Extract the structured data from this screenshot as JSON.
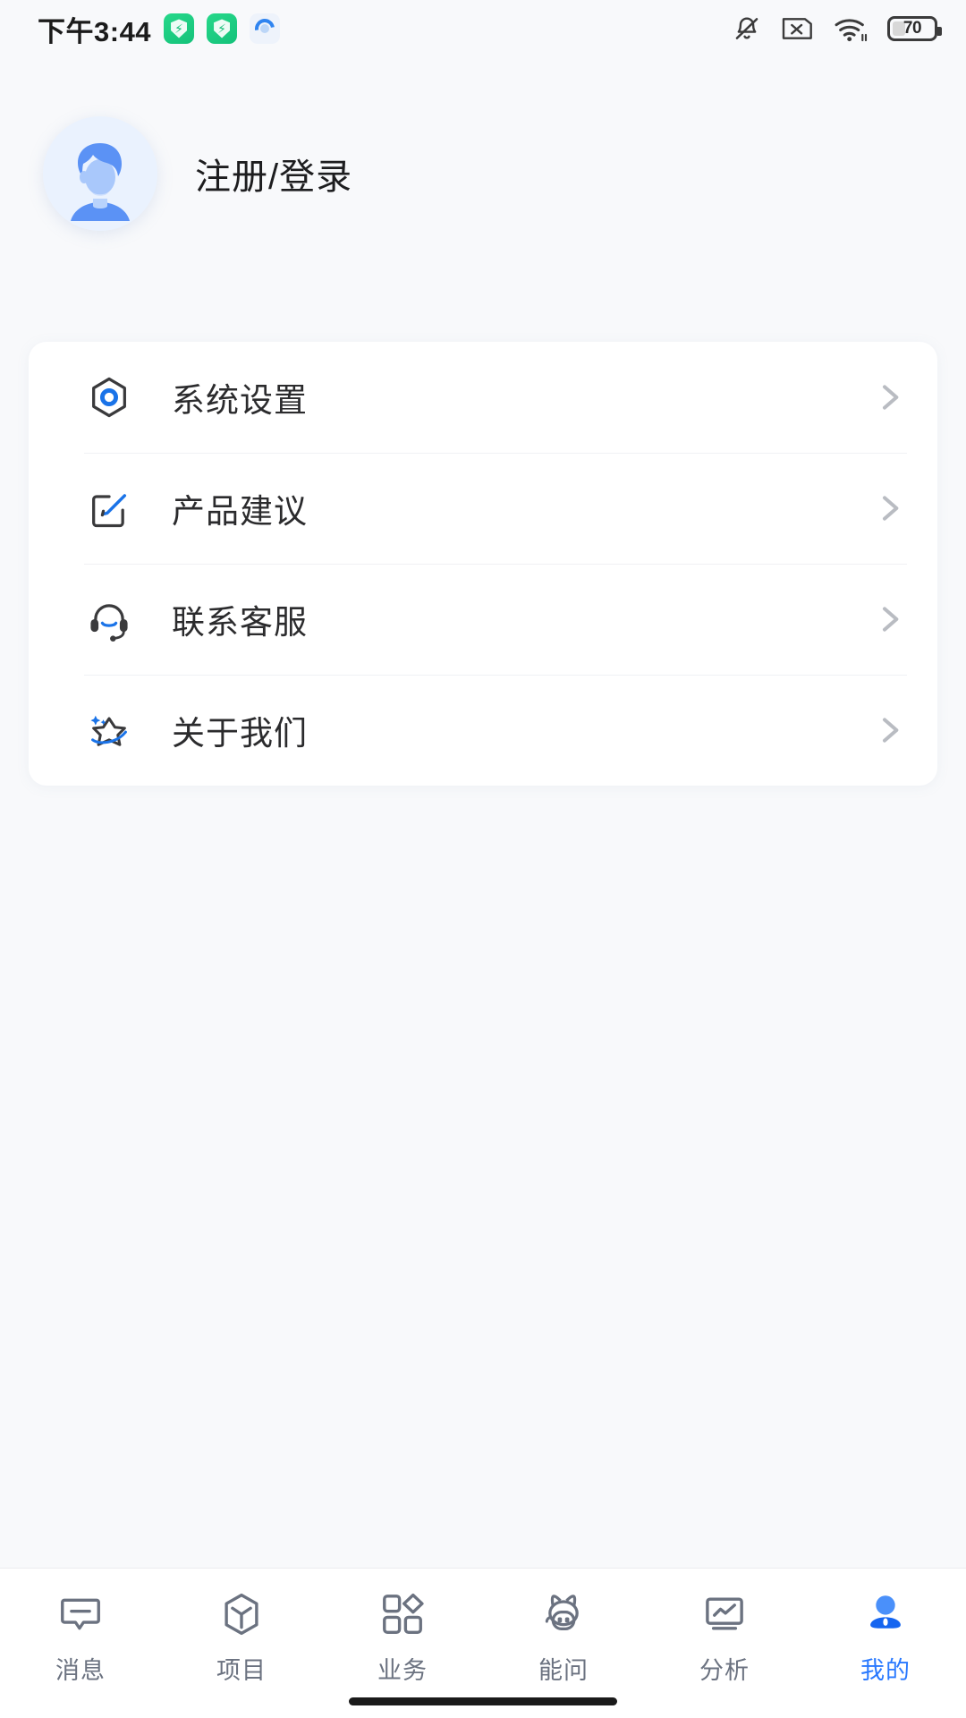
{
  "status_bar": {
    "time": "下午3:44",
    "app_icons": [
      "security-shield-app-icon",
      "security-shield-app-icon-2",
      "browser-app-icon"
    ],
    "icons": [
      "bell-muted-icon",
      "sim-card-disabled-icon",
      "wifi-icon",
      "battery-icon"
    ],
    "battery_percent": "70"
  },
  "profile": {
    "avatar": "default-user-avatar",
    "name": "注册/登录"
  },
  "menu": {
    "items": [
      {
        "label": "系统设置",
        "icon": "settings-hexagon-icon"
      },
      {
        "label": "产品建议",
        "icon": "edit-square-icon"
      },
      {
        "label": "联系客服",
        "icon": "headset-support-icon"
      },
      {
        "label": "关于我们",
        "icon": "star-sparkle-icon"
      }
    ]
  },
  "tabbar": {
    "items": [
      {
        "label": "消息",
        "icon": "message-bubble-icon",
        "active": false
      },
      {
        "label": "项目",
        "icon": "cube-box-icon",
        "active": false
      },
      {
        "label": "业务",
        "icon": "grid-diamond-icon",
        "active": false
      },
      {
        "label": "能问",
        "icon": "ai-cat-robot-icon",
        "active": false
      },
      {
        "label": "分析",
        "icon": "analytics-monitor-icon",
        "active": false
      },
      {
        "label": "我的",
        "icon": "user-person-icon",
        "active": true
      }
    ]
  },
  "colors": {
    "accent": "#2979ff",
    "page_bg": "#f8f9fb",
    "card_bg": "#ffffff",
    "text_primary": "#2b2b2d",
    "text_muted": "#6b7280"
  }
}
